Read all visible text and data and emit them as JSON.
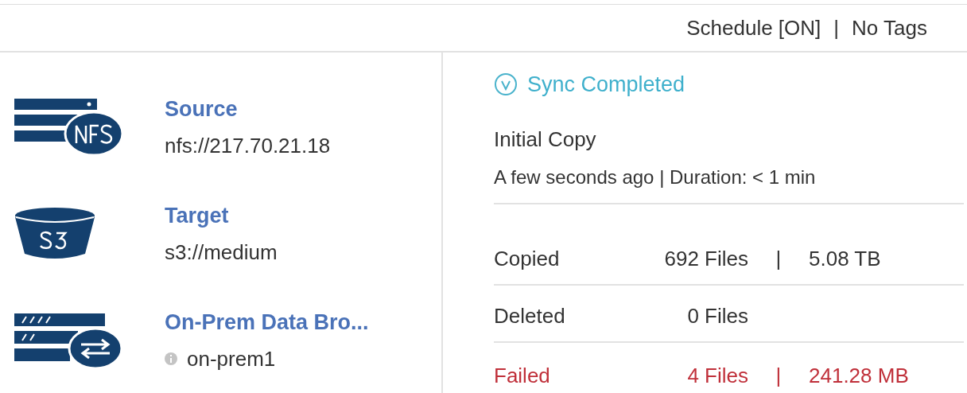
{
  "header": {
    "schedule": "Schedule [ON]",
    "separator": "|",
    "tags": "No Tags"
  },
  "endpoints": [
    {
      "kind": "nfs",
      "title": "Source",
      "value": "nfs://217.70.21.18",
      "info": false
    },
    {
      "kind": "s3",
      "title": "Target",
      "value": "s3://medium",
      "info": false
    },
    {
      "kind": "broker",
      "title": "On-Prem Data Bro...",
      "value": "on-prem1",
      "info": true
    }
  ],
  "status": {
    "label": "Sync Completed",
    "kind": "success"
  },
  "run": {
    "title": "Initial Copy",
    "detail": "A few seconds ago | Duration: < 1 min"
  },
  "stats": [
    {
      "kind": "normal",
      "label": "Copied",
      "files": "692 Files",
      "separator": "|",
      "size": "5.08 TB"
    },
    {
      "kind": "normal",
      "label": "Deleted",
      "files": "0 Files"
    },
    {
      "kind": "error",
      "label": "Failed",
      "files": "4 Files",
      "separator": "|",
      "size": "241.28 MB"
    }
  ]
}
